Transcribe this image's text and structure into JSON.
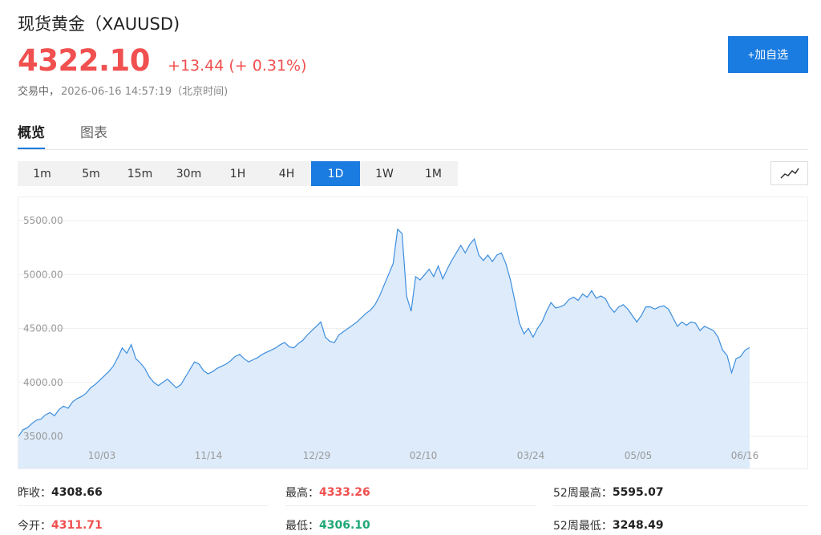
{
  "header": {
    "title": "现货黄金（XAUUSD)",
    "price": "4322.10",
    "change": "+13.44 (+ 0.31%)",
    "status": "交易中，",
    "datetime": "2026-06-16 14:57:19（北京时间)",
    "add_label": "+加自选"
  },
  "tabs": [
    {
      "label": "概览",
      "active": true
    },
    {
      "label": "图表",
      "active": false
    }
  ],
  "periods": [
    {
      "label": "1m",
      "active": false
    },
    {
      "label": "5m",
      "active": false
    },
    {
      "label": "15m",
      "active": false
    },
    {
      "label": "30m",
      "active": false
    },
    {
      "label": "1H",
      "active": false
    },
    {
      "label": "4H",
      "active": false
    },
    {
      "label": "1D",
      "active": true
    },
    {
      "label": "1W",
      "active": false
    },
    {
      "label": "1M",
      "active": false
    }
  ],
  "chart_type_icon": "line-chart-icon",
  "colors": {
    "accent": "#1a7be0",
    "up": "#f0504f",
    "down": "#1fa777",
    "line": "#3d8ede",
    "fill": "#ddebfb"
  },
  "stats": {
    "prev_close": {
      "label": "昨收：",
      "value": "4308.66"
    },
    "high": {
      "label": "最高：",
      "value": "4333.26"
    },
    "high52": {
      "label": "52周最高：",
      "value": "5595.07"
    },
    "open": {
      "label": "今开：",
      "value": "4311.71"
    },
    "low": {
      "label": "最低：",
      "value": "4306.10"
    },
    "low52": {
      "label": "52周最低：",
      "value": "3248.49"
    }
  },
  "chart_data": {
    "type": "area",
    "title": "",
    "xlabel": "",
    "ylabel": "",
    "ylim": [
      3450,
      5700
    ],
    "yticks": [
      "3500.00",
      "4000.00",
      "4500.00",
      "5000.00",
      "5500.00"
    ],
    "xticks": [
      "10/03",
      "11/14",
      "12/29",
      "02/10",
      "03/24",
      "05/05",
      "06/16"
    ],
    "grid": true,
    "series": [
      {
        "values": [
          3500,
          3560,
          3580,
          3620,
          3650,
          3660,
          3700,
          3720,
          3690,
          3750,
          3780,
          3760,
          3820,
          3850,
          3870,
          3900,
          3950,
          3980,
          4020,
          4060,
          4100,
          4150,
          4230,
          4320,
          4270,
          4350,
          4220,
          4180,
          4130,
          4050,
          4000,
          3970,
          4000,
          4030,
          3990,
          3950,
          3980,
          4050,
          4120,
          4190,
          4170,
          4110,
          4080,
          4100,
          4130,
          4150,
          4170,
          4200,
          4240,
          4260,
          4220,
          4190,
          4210,
          4230,
          4260,
          4280,
          4300,
          4320,
          4350,
          4370,
          4330,
          4320,
          4360,
          4390,
          4440,
          4480,
          4520,
          4560,
          4420,
          4380,
          4370,
          4440,
          4470,
          4500,
          4530,
          4560,
          4600,
          4640,
          4670,
          4720,
          4800,
          4900,
          5000,
          5100,
          5420,
          5380,
          4800,
          4660,
          4980,
          4950,
          5000,
          5050,
          4980,
          5080,
          4960,
          5050,
          5130,
          5200,
          5270,
          5200,
          5280,
          5330,
          5180,
          5130,
          5180,
          5120,
          5180,
          5200,
          5100,
          4950,
          4750,
          4550,
          4450,
          4500,
          4420,
          4500,
          4560,
          4660,
          4740,
          4690,
          4700,
          4720,
          4770,
          4790,
          4760,
          4820,
          4790,
          4850,
          4780,
          4800,
          4780,
          4700,
          4650,
          4700,
          4720,
          4680,
          4620,
          4560,
          4620,
          4700,
          4700,
          4680,
          4700,
          4710,
          4680,
          4600,
          4520,
          4560,
          4530,
          4560,
          4550,
          4480,
          4520,
          4500,
          4480,
          4420,
          4300,
          4250,
          4090,
          4220,
          4240,
          4300,
          4322
        ]
      }
    ]
  }
}
